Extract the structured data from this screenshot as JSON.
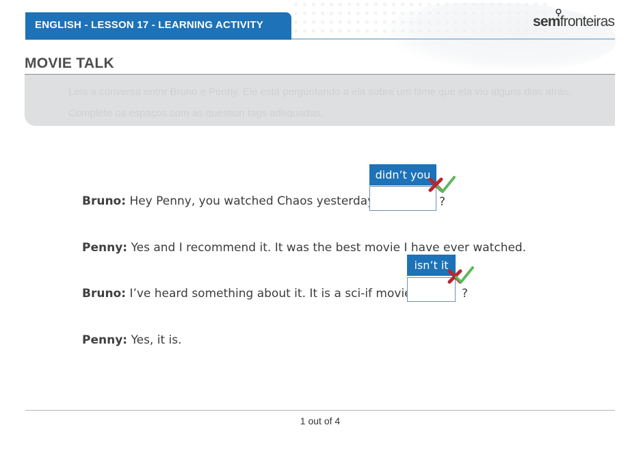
{
  "header": {
    "lesson_title": "ENGLISH - LESSON 17 - LEARNING ACTIVITY",
    "logo_part1": "sem",
    "logo_part2": "fronteiras"
  },
  "page": {
    "title": "MOVIE TALK",
    "instructions": "Leia a conversa entre Bruno e Penny. Ele está perguntando a ela sobre um filme que ela viu alguns dias atrás. Complete os espaços com as question tags adequadas."
  },
  "dialogue": [
    {
      "speaker": "Bruno:",
      "text": "Hey Penny, you watched Chaos yesterday,",
      "answer": "didn’t you",
      "input_value": "",
      "after": "?"
    },
    {
      "speaker": "Penny:",
      "text": "Yes and I recommend it. It was the best movie I have ever watched."
    },
    {
      "speaker": "Bruno:",
      "text": "I’ve heard something about it. It is a sci-if movie,",
      "answer": "isn’t it",
      "input_value": "",
      "after": "?"
    },
    {
      "speaker": "Penny:",
      "text": "Yes, it is."
    }
  ],
  "footer": {
    "pagination": "1 out of 4"
  },
  "colors": {
    "brand_blue": "#1d72b8",
    "wrong_red": "#b8272e",
    "correct_green": "#5cb85c"
  },
  "icons": [
    "pin-icon",
    "wrong-x-icon",
    "correct-check-icon"
  ]
}
